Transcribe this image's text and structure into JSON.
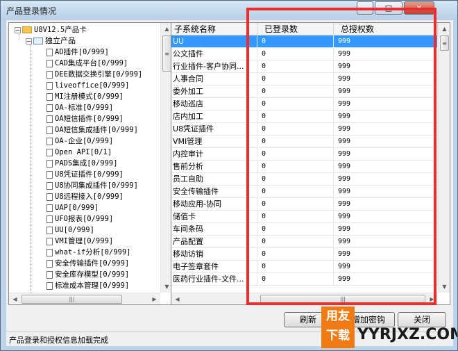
{
  "window": {
    "title": "产品登录情况"
  },
  "tree": {
    "root": "U8V12.5产品卡",
    "group": "独立产品",
    "items": [
      "AD插件[0/999]",
      "CAD集成平台[0/999]",
      "DEE数据交换引擎[0/999]",
      "liveoffice[0/999]",
      "MI注册模式[0/999]",
      "OA-标准[0/999]",
      "OA短信插件[0/999]",
      "OA短信集成插件[0/999]",
      "OA-企业[0/999]",
      "Open API[0/1]",
      "PADS集成[0/999]",
      "U8凭证插件[0/999]",
      "U8协同集成插件[0/999]",
      "U8远程接入[0/999]",
      "UAP[0/999]",
      "UFO报表[0/999]",
      "UU[0/999]",
      "VMI管理[0/999]",
      "what-if分析[0/999]",
      "安全传输插件[0/999]",
      "安全库存模型[0/999]",
      "标准成本管理[0/999]"
    ]
  },
  "grid": {
    "columns": [
      "子系统名称",
      "已登录数",
      "总授权数"
    ],
    "rows": [
      [
        "UU",
        "0",
        "999"
      ],
      [
        "公文插件",
        "0",
        "999"
      ],
      [
        "行业插件-客户协同...",
        "0",
        "999"
      ],
      [
        "人事合同",
        "0",
        "999"
      ],
      [
        "委外加工",
        "0",
        "999"
      ],
      [
        "移动巡店",
        "0",
        "999"
      ],
      [
        "店内加工",
        "0",
        "999"
      ],
      [
        "U8凭证插件",
        "0",
        "999"
      ],
      [
        "VMI管理",
        "0",
        "999"
      ],
      [
        "内控审计",
        "0",
        "999"
      ],
      [
        "售前分析",
        "0",
        "999"
      ],
      [
        "员工自助",
        "0",
        "999"
      ],
      [
        "安全传输插件",
        "0",
        "999"
      ],
      [
        "移动应用-协同",
        "0",
        "999"
      ],
      [
        "储值卡",
        "0",
        "999"
      ],
      [
        "车间条码",
        "0",
        "999"
      ],
      [
        "产品配置",
        "0",
        "999"
      ],
      [
        "移动访销",
        "0",
        "999"
      ],
      [
        "电子签章套件",
        "0",
        "999"
      ],
      [
        "医药行业插件-文件...",
        "0",
        "999"
      ]
    ],
    "selected_row": 0
  },
  "buttons": {
    "refresh": "刷新",
    "add_key": "增加密钩",
    "close": "关闭"
  },
  "status": "产品登录和授权信息加载完成",
  "watermark": {
    "badge_line1": "用友",
    "badge_line2": "下载",
    "site": "YYRJXZ.COM"
  },
  "colors": {
    "highlight": "#ef2b2b",
    "selected_row": "#3399ff"
  }
}
